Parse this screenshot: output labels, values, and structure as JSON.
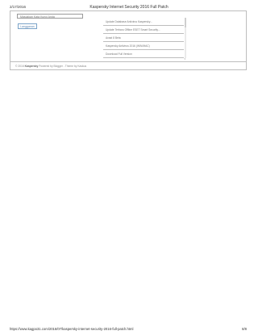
{
  "header": {
    "date": "2/17/2016",
    "title": "Kaspersky Internet Security 2016 Full Patch"
  },
  "search": {
    "placeholder": "Masukkan Kata Kunci Anda"
  },
  "subscribe": {
    "label": "Langganan"
  },
  "list": {
    "items": [
      "Update Database Antivirus Kaspersky...",
      "Update Terbaru Offline ESET Smart Security...",
      "Avast 8 Beta",
      "Kaspersky Antivirus 2016 (WIN/MAC)",
      "Download Full Version"
    ]
  },
  "footer": {
    "prefix": "© 2016",
    "brand": "Kaspersky",
    "suffix": "Powered by Blogger - Theme by Kaskus"
  },
  "page_footer": {
    "url": "https://www.kagpo31.com/2016/07/kaspersky-internet-security-2016-full-patch.html",
    "page": "8/8"
  }
}
